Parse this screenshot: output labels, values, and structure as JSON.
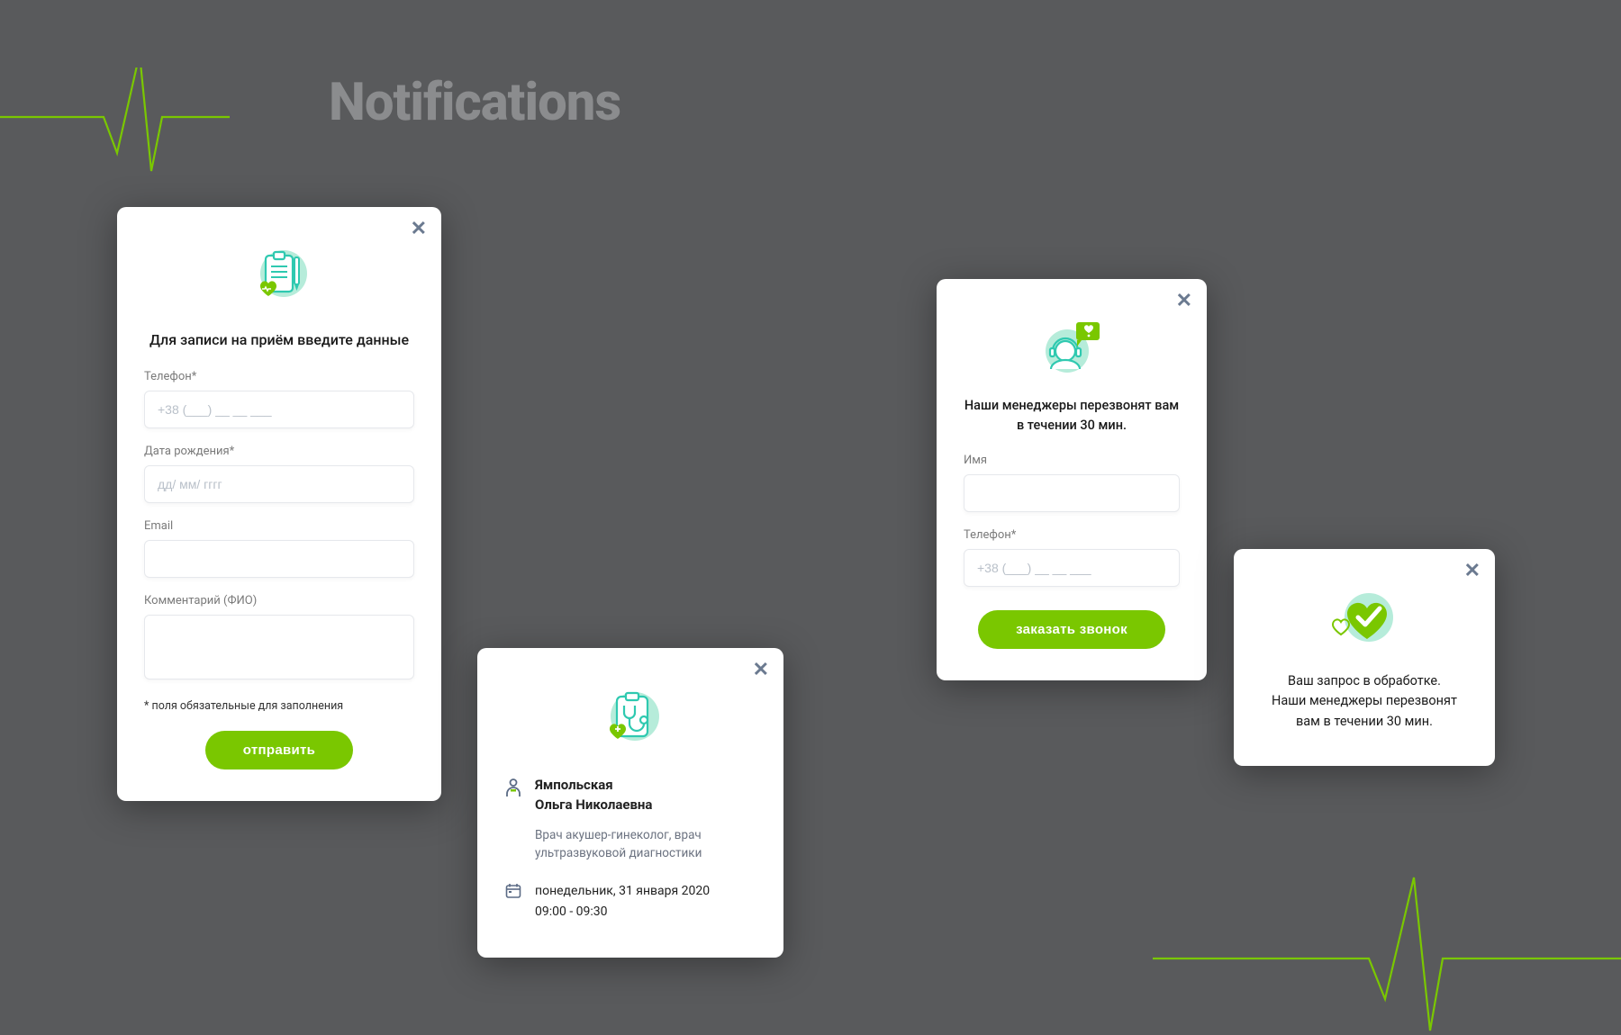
{
  "page": {
    "title": "Notifications"
  },
  "colors": {
    "accent": "#7ac700",
    "teal": "#2fc9b0",
    "mint": "#b6ecda",
    "close": "#6b7a90"
  },
  "appt_card": {
    "heading": "Для записи на приём введите данные",
    "phone_label": "Телефон*",
    "phone_placeholder": "+38 (___) __ __ ___",
    "dob_label": "Дата рождения*",
    "dob_placeholder": "дд/ мм/ гггг",
    "email_label": "Email",
    "comment_label": "Комментарий (ФИО)",
    "hint": "* поля обязательные для заполнения",
    "submit": "отправить"
  },
  "confirm_card": {
    "name_line1": "Ямпольская",
    "name_line2": "Ольга Николаевна",
    "specialty": "Врач акушер-гинеколог, врач ультразвуковой диагностики",
    "date_line1": "понедельник, 31 января 2020",
    "date_line2": "09:00 - 09:30"
  },
  "callback_card": {
    "heading_line1": "Наши менеджеры перезвонят вам",
    "heading_line2": "в течении 30 мин.",
    "name_label": "Имя",
    "phone_label": "Телефон*",
    "phone_placeholder": "+38 (___) __ __ ___",
    "submit": "заказать звонок"
  },
  "success_card": {
    "line1": "Ваш запрос в обработке.",
    "line2": "Наши менеджеры перезвонят",
    "line3": "вам в течении 30 мин."
  }
}
